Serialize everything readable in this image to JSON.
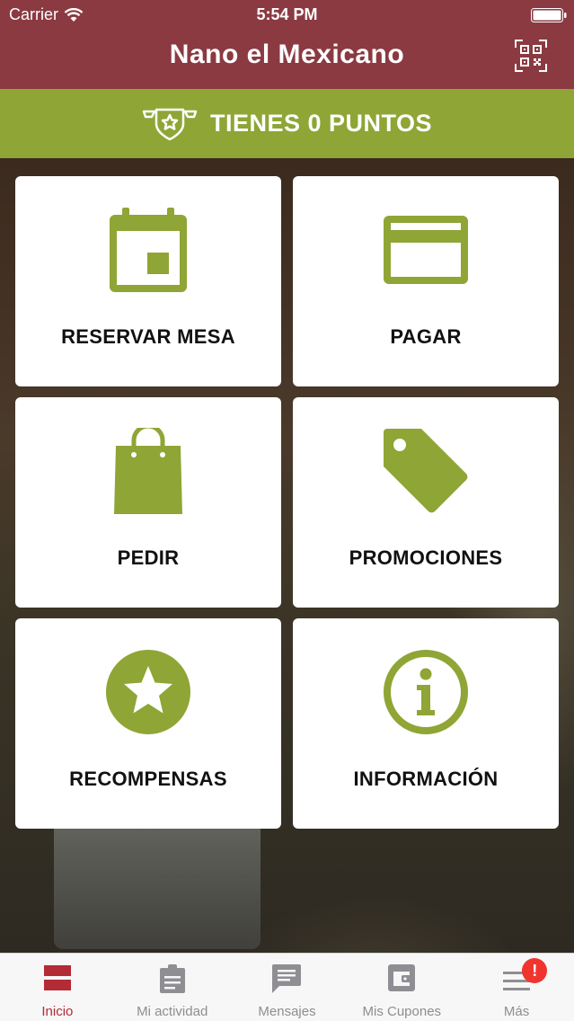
{
  "status_bar": {
    "carrier": "Carrier",
    "time": "5:54 PM"
  },
  "header": {
    "title": "Nano el Mexicano",
    "qr_icon": "qr-code-icon"
  },
  "points": {
    "text": "TIENES 0 PUNTOS",
    "icon": "badge-star-icon"
  },
  "tiles": [
    {
      "label": "RESERVAR MESA",
      "icon": "calendar-icon"
    },
    {
      "label": "PAGAR",
      "icon": "credit-card-icon"
    },
    {
      "label": "PEDIR",
      "icon": "shopping-bag-icon"
    },
    {
      "label": "PROMOCIONES",
      "icon": "tag-icon"
    },
    {
      "label": "RECOMPENSAS",
      "icon": "star-icon"
    },
    {
      "label": "INFORMACIÓN",
      "icon": "info-icon"
    }
  ],
  "tabbar": {
    "items": [
      {
        "label": "Inicio",
        "icon": "home-icon",
        "active": true
      },
      {
        "label": "Mi actividad",
        "icon": "clipboard-icon"
      },
      {
        "label": "Mensajes",
        "icon": "message-icon"
      },
      {
        "label": "Mis Cupones",
        "icon": "wallet-icon"
      },
      {
        "label": "Más",
        "icon": "menu-icon",
        "badge": "!"
      }
    ]
  },
  "colors": {
    "header": "#8b3a42",
    "accent_green": "#8fa535",
    "active_tab": "#b32b34",
    "badge": "#f0352f"
  }
}
